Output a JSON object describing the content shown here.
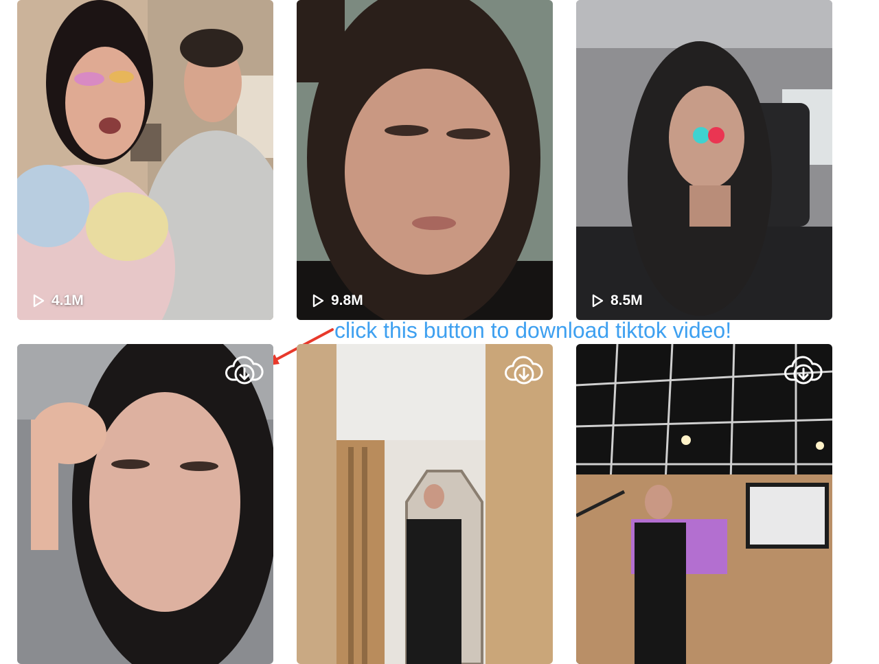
{
  "videos": [
    {
      "views": "4.1M",
      "has_download": false
    },
    {
      "views": "9.8M",
      "has_download": false
    },
    {
      "views": "8.5M",
      "has_download": false
    },
    {
      "views": "",
      "has_download": true
    },
    {
      "views": "",
      "has_download": true
    },
    {
      "views": "",
      "has_download": true
    }
  ],
  "annotation": {
    "text": "click this button to download tiktok video!",
    "color": "#3ea0f0",
    "arrow_color": "#e8392b"
  },
  "icons": {
    "play": "play-icon",
    "download": "cloud-download-icon"
  }
}
